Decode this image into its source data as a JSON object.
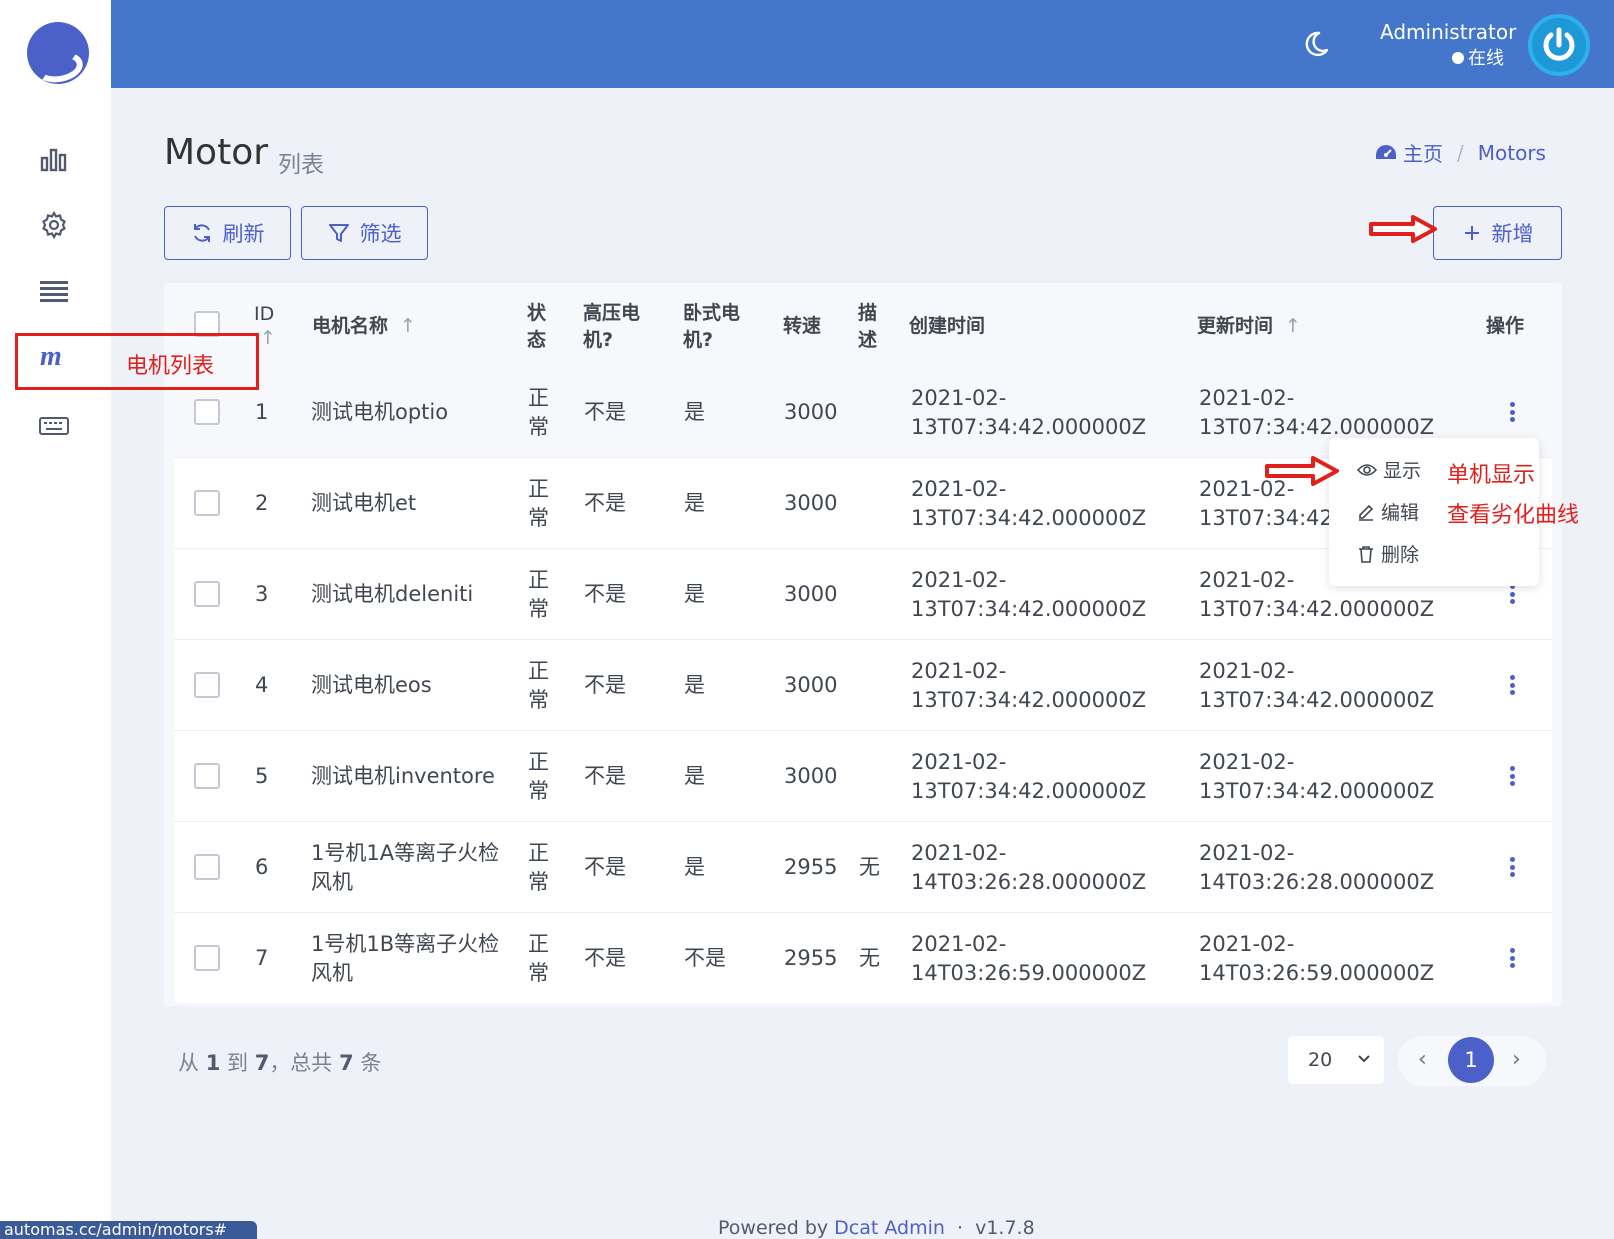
{
  "header": {
    "user_name": "Administrator",
    "user_status": "在线"
  },
  "page": {
    "title": "Motor",
    "subtitle": "列表"
  },
  "breadcrumb": {
    "home": "主页",
    "separator": "/",
    "current": "Motors"
  },
  "toolbar": {
    "refresh": "刷新",
    "filter": "筛选",
    "create": "新增"
  },
  "table": {
    "headers": {
      "id": "ID",
      "name": "电机名称",
      "status_l1": "状",
      "status_l2": "态",
      "hv_l1": "高压电",
      "hv_l2": "机?",
      "horizontal_l1": "卧式电",
      "horizontal_l2": "机?",
      "speed": "转速",
      "desc_l1": "描",
      "desc_l2": "述",
      "created": "创建时间",
      "updated": "更新时间",
      "actions": "操作"
    },
    "rows": [
      {
        "id": "1",
        "name_l1": "测试电机optio",
        "name_l2": "",
        "status_l1": "正",
        "status_l2": "常",
        "hv": "不是",
        "horizontal": "是",
        "speed": "3000",
        "desc": "",
        "created_l1": "2021-02-",
        "created_l2": "13T07:34:42.000000Z",
        "updated_l1": "2021-02-",
        "updated_l2": "13T07:34:42.000000Z"
      },
      {
        "id": "2",
        "name_l1": "测试电机et",
        "name_l2": "",
        "status_l1": "正",
        "status_l2": "常",
        "hv": "不是",
        "horizontal": "是",
        "speed": "3000",
        "desc": "",
        "created_l1": "2021-02-",
        "created_l2": "13T07:34:42.000000Z",
        "updated_l1": "2021-02-",
        "updated_l2": "13T07:34:42."
      },
      {
        "id": "3",
        "name_l1": "测试电机deleniti",
        "name_l2": "",
        "status_l1": "正",
        "status_l2": "常",
        "hv": "不是",
        "horizontal": "是",
        "speed": "3000",
        "desc": "",
        "created_l1": "2021-02-",
        "created_l2": "13T07:34:42.000000Z",
        "updated_l1": "2021-02-",
        "updated_l2": "13T07:34:42.000000Z"
      },
      {
        "id": "4",
        "name_l1": "测试电机eos",
        "name_l2": "",
        "status_l1": "正",
        "status_l2": "常",
        "hv": "不是",
        "horizontal": "是",
        "speed": "3000",
        "desc": "",
        "created_l1": "2021-02-",
        "created_l2": "13T07:34:42.000000Z",
        "updated_l1": "2021-02-",
        "updated_l2": "13T07:34:42.000000Z"
      },
      {
        "id": "5",
        "name_l1": "测试电机inventore",
        "name_l2": "",
        "status_l1": "正",
        "status_l2": "常",
        "hv": "不是",
        "horizontal": "是",
        "speed": "3000",
        "desc": "",
        "created_l1": "2021-02-",
        "created_l2": "13T07:34:42.000000Z",
        "updated_l1": "2021-02-",
        "updated_l2": "13T07:34:42.000000Z"
      },
      {
        "id": "6",
        "name_l1": "1号机1A等离子火检",
        "name_l2": "风机",
        "status_l1": "正",
        "status_l2": "常",
        "hv": "不是",
        "horizontal": "是",
        "speed": "2955",
        "desc": "无",
        "created_l1": "2021-02-",
        "created_l2": "14T03:26:28.000000Z",
        "updated_l1": "2021-02-",
        "updated_l2": "14T03:26:28.000000Z"
      },
      {
        "id": "7",
        "name_l1": "1号机1B等离子火检",
        "name_l2": "风机",
        "status_l1": "正",
        "status_l2": "常",
        "hv": "不是",
        "horizontal": "不是",
        "speed": "2955",
        "desc": "无",
        "created_l1": "2021-02-",
        "created_l2": "14T03:26:59.000000Z",
        "updated_l1": "2021-02-",
        "updated_l2": "14T03:26:59.000000Z"
      }
    ]
  },
  "row_menu": {
    "show": "显示",
    "edit": "编辑",
    "delete": "删除"
  },
  "annotations": {
    "motor_list": "电机列表",
    "single_show": "单机显示",
    "degradation_curve": "查看劣化曲线"
  },
  "footer": {
    "from_label": "从",
    "from": "1",
    "to_label": "到",
    "to": "7",
    "total_label": "，总共",
    "total": "7",
    "unit": "条",
    "per_page": "20",
    "current_page": "1",
    "powered_by": "Powered by",
    "brand": "Dcat Admin",
    "dot": "·",
    "version": "v1.7.8"
  },
  "status_url": "automas.cc/admin/motors#",
  "colors": {
    "primary": "#4c60c9",
    "header_bg": "#4477cc",
    "annotation": "#e0201c"
  }
}
